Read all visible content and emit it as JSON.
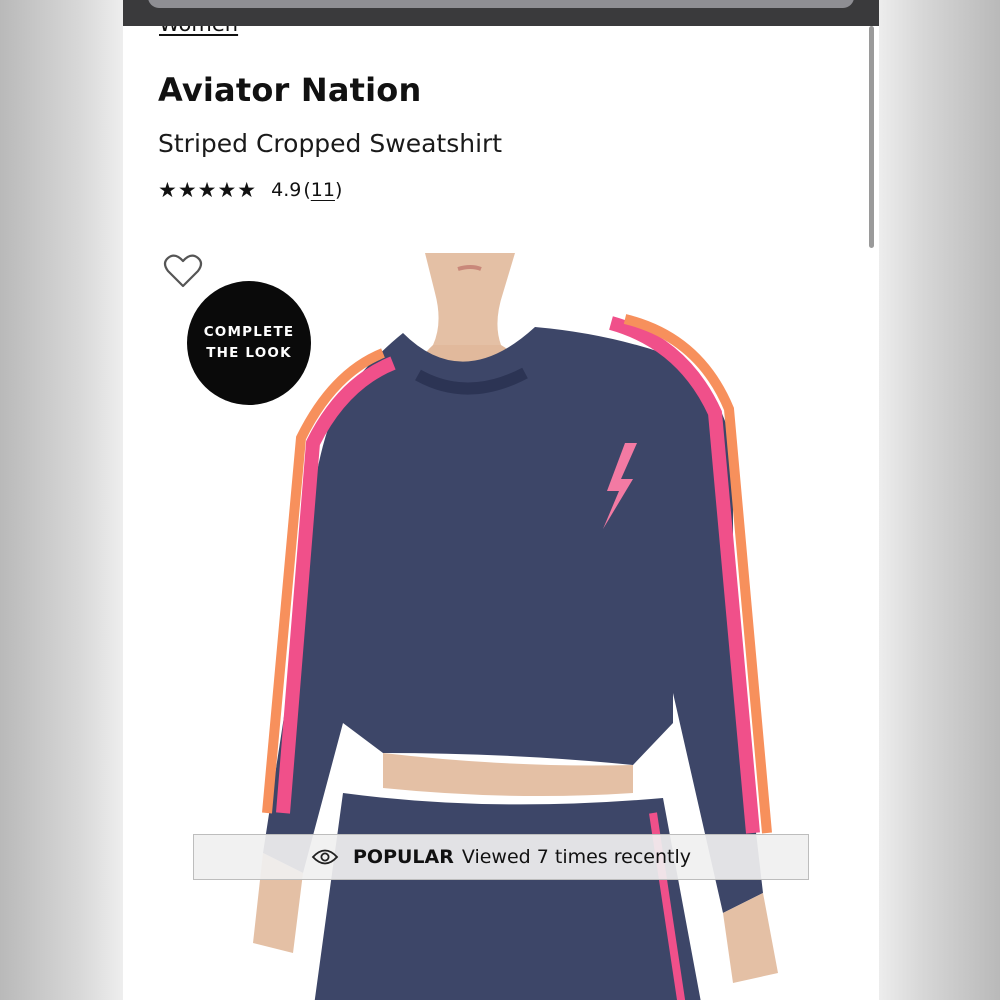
{
  "breadcrumb": {
    "label": "Women"
  },
  "product": {
    "brand": "Aviator Nation",
    "name": "Striped Cropped Sweatshirt",
    "rating": {
      "stars": "★★★★★",
      "value": "4.9",
      "open": "(",
      "count": "11",
      "close": ")"
    }
  },
  "image": {
    "badge": {
      "line1": "COMPLETE",
      "line2": "THE LOOK"
    },
    "colors": {
      "navy": "#3d4668",
      "navy_dark": "#2c3454",
      "pink": "#f0508a",
      "orange": "#f7905c",
      "skin": "#e4c0a5",
      "bolt": "#f37aa3"
    }
  },
  "popular": {
    "label": "POPULAR",
    "text": "Viewed 7 times recently"
  },
  "icons": {
    "heart": "heart-icon",
    "eye": "eye-icon",
    "chevron": "chevron-down-icon"
  }
}
